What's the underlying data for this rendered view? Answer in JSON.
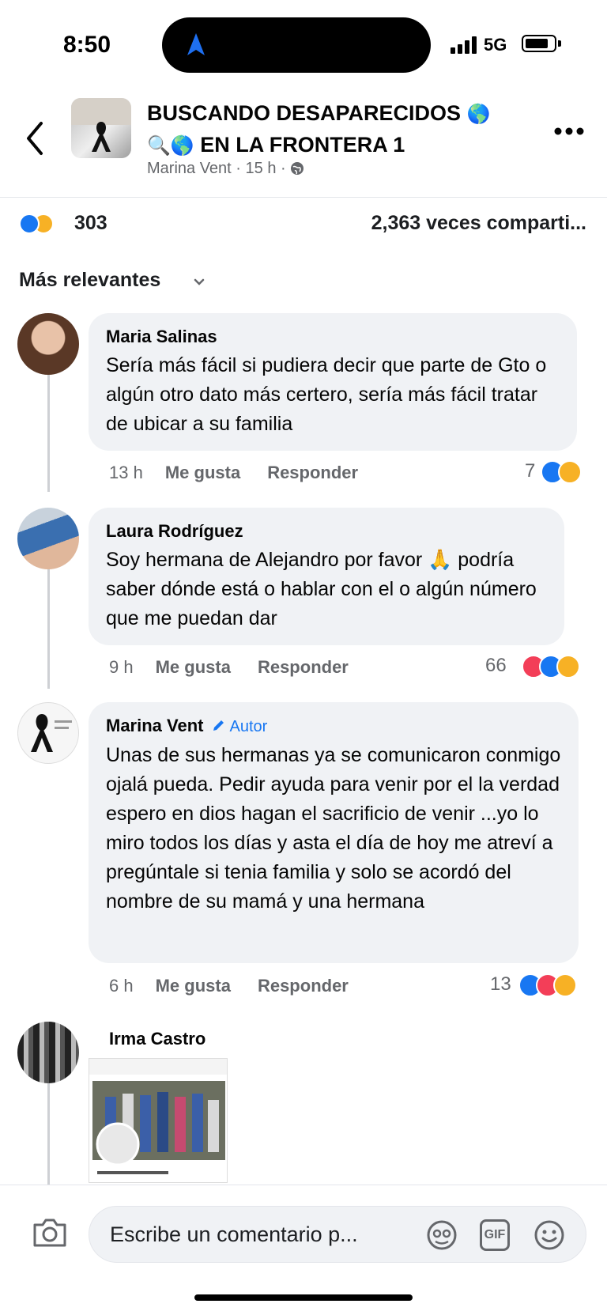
{
  "status_bar": {
    "time": "8:50",
    "network": "5G"
  },
  "header": {
    "title_line1": "BUSCANDO DESAPARECIDOS",
    "title_line2": "EN LA FRONTERA 1",
    "emoji_globe": "🌎",
    "emoji_search": "🔍",
    "author": "Marina Vent",
    "time": "15 h",
    "separator": "·"
  },
  "post_stats": {
    "reaction_count": "303",
    "shares": "2,363 veces comparti..."
  },
  "sort": {
    "label": "Más relevantes"
  },
  "comments": [
    {
      "name": "Maria Salinas",
      "text": "Sería más fácil si pudiera decir que parte de Gto o algún otro dato más certero, sería más fácil tratar de ubicar a su familia",
      "time": "13 h",
      "like": "Me gusta",
      "reply": "Responder",
      "reactions": "7"
    },
    {
      "name": "Laura Rodríguez",
      "text": "Soy hermana de Alejandro por favor 🙏 podría saber dónde está o hablar con el o algún número que me puedan dar",
      "time": "9 h",
      "like": "Me gusta",
      "reply": "Responder",
      "reactions": "66"
    },
    {
      "name": "Marina Vent",
      "badge": "Autor",
      "text": "Unas de sus hermanas ya se comunicaron conmigo ojalá pueda. Pedir ayuda para venir por el la verdad espero en dios hagan el sacrificio de venir ...yo lo miro todos los días y asta el día de hoy me atreví a pregúntale si tenia familia y solo se acordó del nombre de su mamá y una hermana",
      "time": "6 h",
      "like": "Me gusta",
      "reply": "Responder",
      "reactions": "13"
    },
    {
      "name": "Irma Castro"
    }
  ],
  "composer": {
    "placeholder": "Escribe un comentario p...",
    "gif_label": "GIF"
  },
  "colors": {
    "like_blue": "#1877f2",
    "love_red": "#f33e58",
    "haha_yellow": "#f7b125",
    "bubble": "#f0f2f5"
  }
}
